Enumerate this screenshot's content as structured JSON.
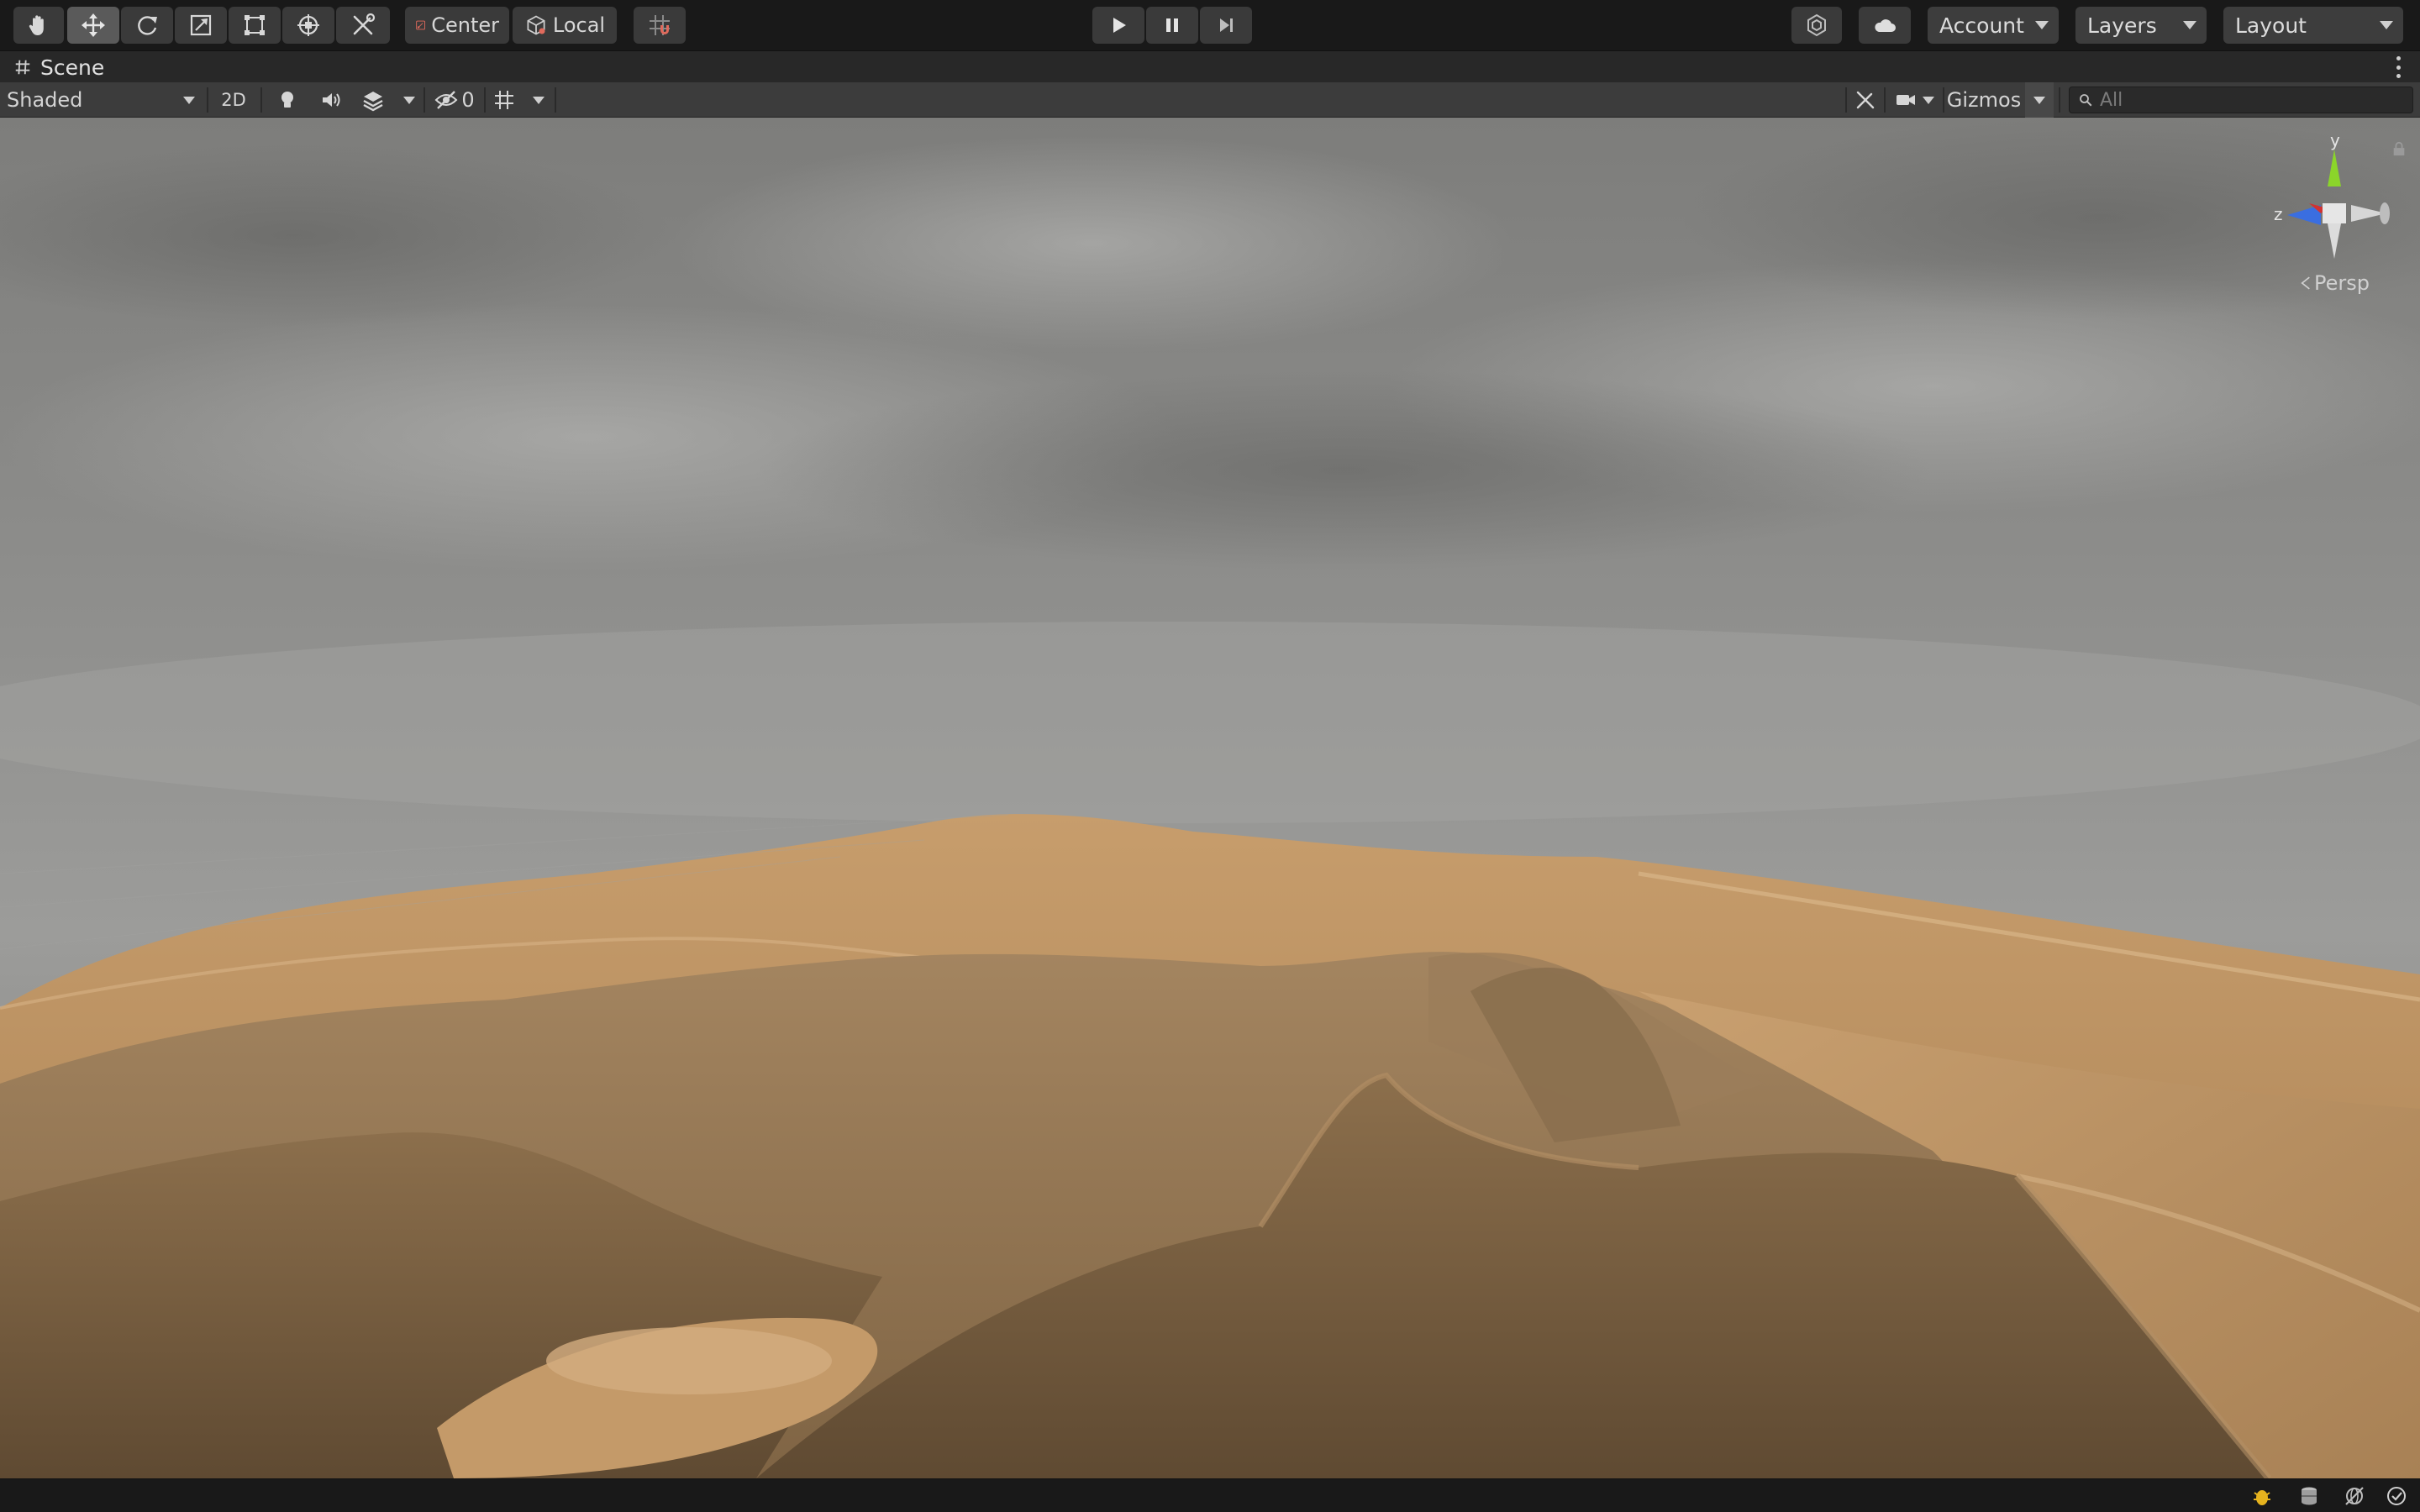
{
  "toolbar": {
    "tools": [
      {
        "name": "hand-tool-icon"
      },
      {
        "name": "move-tool-icon"
      },
      {
        "name": "rotate-tool-icon"
      },
      {
        "name": "scale-tool-icon"
      },
      {
        "name": "rect-tool-icon"
      },
      {
        "name": "transform-tool-icon"
      },
      {
        "name": "custom-tools-icon"
      }
    ],
    "pivot_mode_label": "Center",
    "pivot_rotation_label": "Local",
    "account_label": "Account",
    "layers_label": "Layers",
    "layout_label": "Layout"
  },
  "tab": {
    "title": "Scene"
  },
  "scene_toolbar": {
    "draw_mode": "Shaded",
    "mode_2d_label": "2D",
    "hidden_count": "0",
    "gizmos_label": "Gizmos",
    "search_placeholder": "All"
  },
  "viewport": {
    "projection_label": "Persp",
    "axis_labels": {
      "y": "y",
      "z": "z"
    }
  },
  "colors": {
    "background": "#191919",
    "toolbar_button": "#3a3a3a",
    "active_button": "#5a5a5a",
    "scene_toolbar": "#3c3c3c",
    "sky": "#8c8c8a",
    "sand": "#b08a5c",
    "axis_y": "#8bd52a",
    "axis_x": "#d13232",
    "axis_z": "#3a6ee0"
  }
}
